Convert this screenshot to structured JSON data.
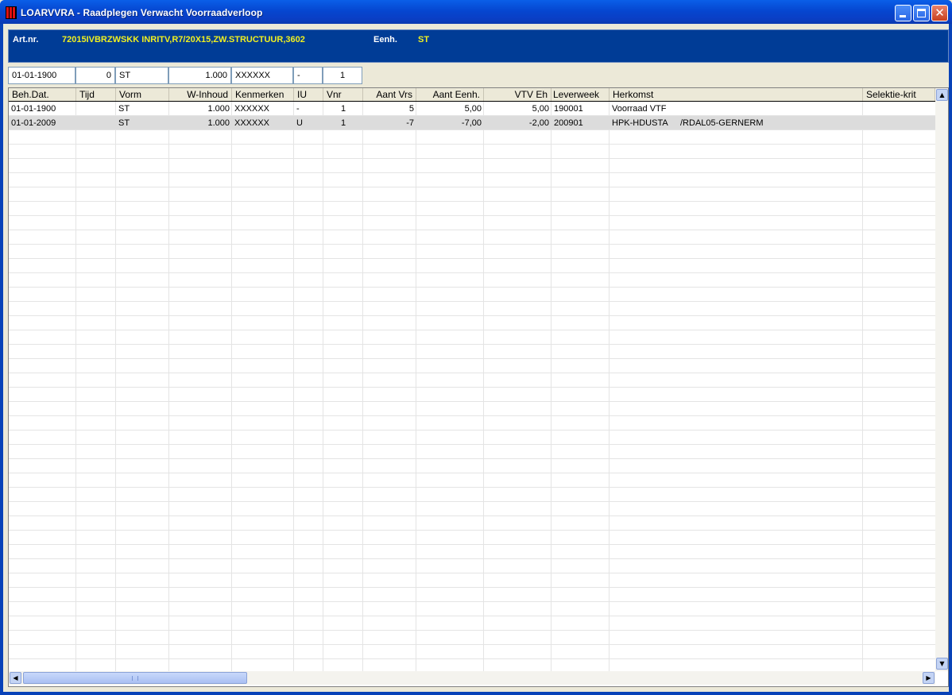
{
  "window": {
    "title": "LOARVVRA - Raadplegen Verwacht Voorraadverloop"
  },
  "header": {
    "art_label": "Art.nr.",
    "art_value": "72015IVBRZWSKK  INRITV,R7/20X15,ZW.STRUCTUUR,3602",
    "eenh_label": "Eenh.",
    "eenh_value": "ST"
  },
  "filter": [
    "01-01-1900",
    "0",
    "ST",
    "1.000",
    "XXXXXX",
    "-",
    "1"
  ],
  "columns": [
    "Beh.Dat.",
    "Tijd",
    "Vorm",
    "W-Inhoud",
    "Kenmerken",
    "IU",
    "Vnr",
    "Aant Vrs",
    "Aant Eenh.",
    "VTV Eh",
    "Leverweek",
    "Herkomst",
    "Selektie-krit"
  ],
  "rows": [
    {
      "beh_dat": "01-01-1900",
      "tijd": "",
      "vorm": "ST",
      "w_inhoud": "1.000",
      "kenmerken": "XXXXXX",
      "iu": "-",
      "vnr": "1",
      "aant_vrs": "5",
      "aant_eenh": "5,00",
      "vtv_eh": "5,00",
      "leverweek": "190001",
      "herkomst": "Voorraad VTF",
      "herkomst2": "",
      "selektie": ""
    },
    {
      "beh_dat": "01-01-2009",
      "tijd": "",
      "vorm": "ST",
      "w_inhoud": "1.000",
      "kenmerken": "XXXXXX",
      "iu": "U",
      "vnr": "1",
      "aant_vrs": "-7",
      "aant_eenh": "-7,00",
      "vtv_eh": "-2,00",
      "leverweek": "200901",
      "herkomst": "HPK-HDUSTA",
      "herkomst2": "/RDAL05-GERNERM",
      "selektie": ""
    }
  ],
  "colors": {
    "header_bg": "#003c96",
    "header_value": "#f0f020",
    "titlebar": "#0646d0",
    "selected_row": "#dcdcdc"
  },
  "icons": {
    "app": "app-icon",
    "minimize": "minimize-icon",
    "maximize": "maximize-icon",
    "close": "close-icon",
    "scroll_up": "arrow-up-icon",
    "scroll_down": "arrow-down-icon",
    "scroll_left": "arrow-left-icon",
    "scroll_right": "arrow-right-icon"
  }
}
